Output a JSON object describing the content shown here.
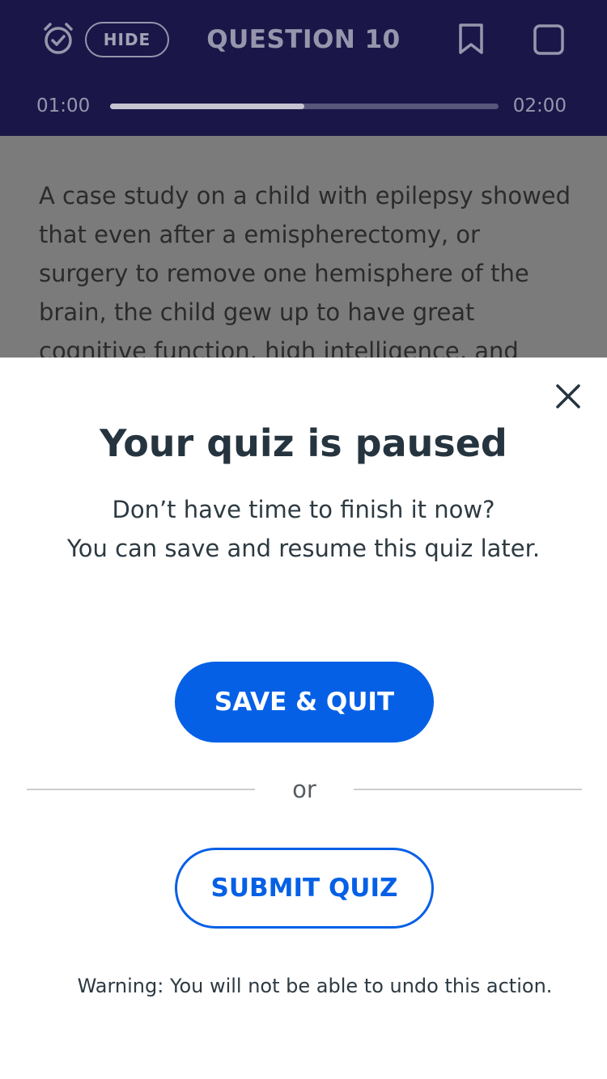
{
  "header": {
    "hide_label": "HIDE",
    "title": "QUESTION 10",
    "time_elapsed": "01:00",
    "time_total": "02:00",
    "progress_percent": 50
  },
  "question": {
    "text": "A case study on a child with epilepsy showed that even after a emispherectomy, or surgery to remove one hemisphere of the brain, the child gew up to have great cognitive function, high intelligence, and"
  },
  "modal": {
    "title": "Your quiz is paused",
    "message_line1": "Don’t have time to finish it now?",
    "message_line2": "You can save and resume this quiz later.",
    "save_label": "SAVE & QUIT",
    "or_label": "or",
    "submit_label": "SUBMIT QUIZ",
    "warning": "Warning: You will not be able to undo this action."
  },
  "colors": {
    "header_bg": "#1a1648",
    "primary_blue": "#0560e6",
    "overlay_gray": "#7b7b7b",
    "title_text": "#25343e"
  },
  "icons": [
    "alarm-check-icon",
    "bookmark-icon",
    "square-icon",
    "close-icon"
  ]
}
